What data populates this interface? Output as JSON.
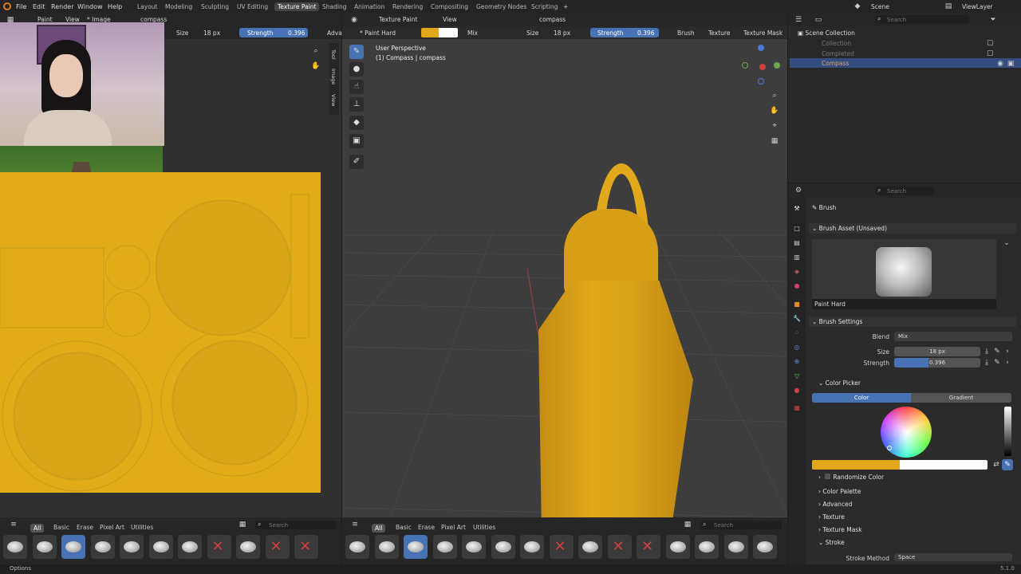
{
  "topbar": {
    "menus": [
      "File",
      "Edit",
      "Render",
      "Window",
      "Help"
    ],
    "workspaces": [
      "Layout",
      "Modeling",
      "Sculpting",
      "UV Editing",
      "Texture Paint",
      "Shading",
      "Animation",
      "Rendering",
      "Compositing",
      "Geometry Nodes",
      "Scripting"
    ],
    "active_workspace": "Texture Paint",
    "add_tab": "+",
    "scene": "Scene",
    "view_layer": "ViewLayer"
  },
  "image_editor": {
    "mode": "Paint",
    "view_menu": "View",
    "image_menu": "* Image",
    "image_name": "compass",
    "size_label": "Size",
    "size_value": "18 px",
    "strength_label": "Strength",
    "strength_value": "0.396",
    "advanced_label": "Adva",
    "side_tabs": [
      "Tool",
      "Image",
      "View"
    ]
  },
  "viewport": {
    "mode": "Texture Paint",
    "view_menu": "View",
    "object_name": "compass",
    "brush_name": "* Paint Hard",
    "blend": "Mix",
    "size_label": "Size",
    "size_value": "18 px",
    "strength_label": "Strength",
    "strength_value": "0.396",
    "brush_menu": "Brush",
    "texture_menu": "Texture",
    "texture_mask_menu": "Texture Mask",
    "perspective": "User Perspective",
    "object_info": "(1) Compass | compass",
    "primary_color": "#e0a81a",
    "secondary_color": "#ffffff"
  },
  "asset_shelf": {
    "left_tabs": [
      "All",
      "Basic",
      "Erase",
      "Pixel Art",
      "Utilities"
    ],
    "right_tabs": [
      "All",
      "Basic",
      "Erase",
      "Pixel Art",
      "Utilities"
    ],
    "search_placeholder": "Search"
  },
  "outliner": {
    "search_placeholder": "Search",
    "root": "Scene Collection",
    "items": [
      "Collection",
      "Completed",
      "Compass"
    ]
  },
  "properties": {
    "search_placeholder": "Search",
    "context": "Brush",
    "brush_asset_header": "Brush Asset (Unsaved)",
    "brush_asset_name": "Paint Hard",
    "brush_settings_header": "Brush Settings",
    "blend_label": "Blend",
    "blend_value": "Mix",
    "size_label": "Size",
    "size_value": "18 px",
    "strength_label": "Strength",
    "strength_value": "0.396",
    "color_picker_header": "Color Picker",
    "color_tab": "Color",
    "gradient_tab": "Gradient",
    "randomize_color": "Randomize Color",
    "collapsed_sections": [
      "Color Palette",
      "Advanced",
      "Texture",
      "Texture Mask"
    ],
    "stroke_header": "Stroke",
    "stroke_method_label": "Stroke Method",
    "stroke_method_value": "Space"
  },
  "statusbar": {
    "left": "Options",
    "version": "5.1.0"
  },
  "colors": {
    "accent": "#4772b3",
    "paint_yellow": "#e0a81a",
    "texture_bg": "#e1ac17"
  },
  "chart_data": null
}
